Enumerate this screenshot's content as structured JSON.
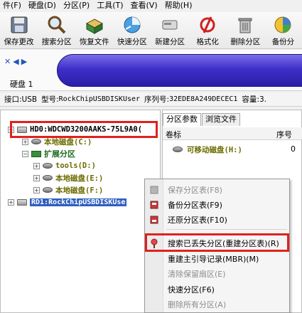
{
  "menu": [
    "件(F)",
    "硬盘(D)",
    "分区(P)",
    "工具(T)",
    "查看(V)",
    "帮助(H)"
  ],
  "toolbar": [
    {
      "label": "保存更改",
      "icon": "save-icon"
    },
    {
      "label": "搜索分区",
      "icon": "magnifier-icon"
    },
    {
      "label": "恢复文件",
      "icon": "recover-box-icon"
    },
    {
      "label": "快速分区",
      "icon": "quick-partition-icon"
    },
    {
      "label": "新建分区",
      "icon": "new-partition-icon"
    },
    {
      "label": "格式化",
      "icon": "format-icon"
    },
    {
      "label": "删除分区",
      "icon": "trash-icon"
    },
    {
      "label": "备份分",
      "icon": "backup-icon"
    }
  ],
  "disk": {
    "label": "硬盘 1"
  },
  "info": {
    "interface": "接口:USB",
    "model_label": "型号:",
    "model": "RockChipUSBDISKUser",
    "serial_label": "序列号:",
    "serial": "32EDE8A249DECEC1",
    "capacity": "容量:3."
  },
  "tree": {
    "hdd": "HD0:WDCWD3200AAKS-75L9A0(",
    "local_c": "本地磁盘(C:)",
    "extended": "扩展分区",
    "tools": "tools(D:)",
    "local_e": "本地磁盘(E:)",
    "local_f": "本地磁盘(F:)",
    "rd1": "RD1:RockChipUSBDISKUse"
  },
  "right": {
    "tabs": [
      "分区参数",
      "浏览文件"
    ],
    "col_label": "卷标",
    "col_number": "序号",
    "row_label": "可移动磁盘(H:)",
    "row_number": "0"
  },
  "context_menu": [
    {
      "label": "保存分区表(F8)",
      "disabled": true
    },
    {
      "label": "备份分区表(F9)",
      "disabled": false
    },
    {
      "label": "还原分区表(F10)",
      "disabled": false
    },
    {
      "label": "搜索已丢失分区(重建分区表)(R)",
      "disabled": false
    },
    {
      "label": "重建主引导记录(MBR)(M)",
      "disabled": false
    },
    {
      "label": "清除保留扇区(E)",
      "disabled": true
    },
    {
      "label": "快速分区(F6)",
      "disabled": false
    },
    {
      "label": "删除所有分区(A)",
      "disabled": true
    }
  ],
  "colors": {
    "highlight_box": "#e0211d",
    "selection": "#2f5fbf",
    "disk_capsule": "#3e2fc8"
  }
}
